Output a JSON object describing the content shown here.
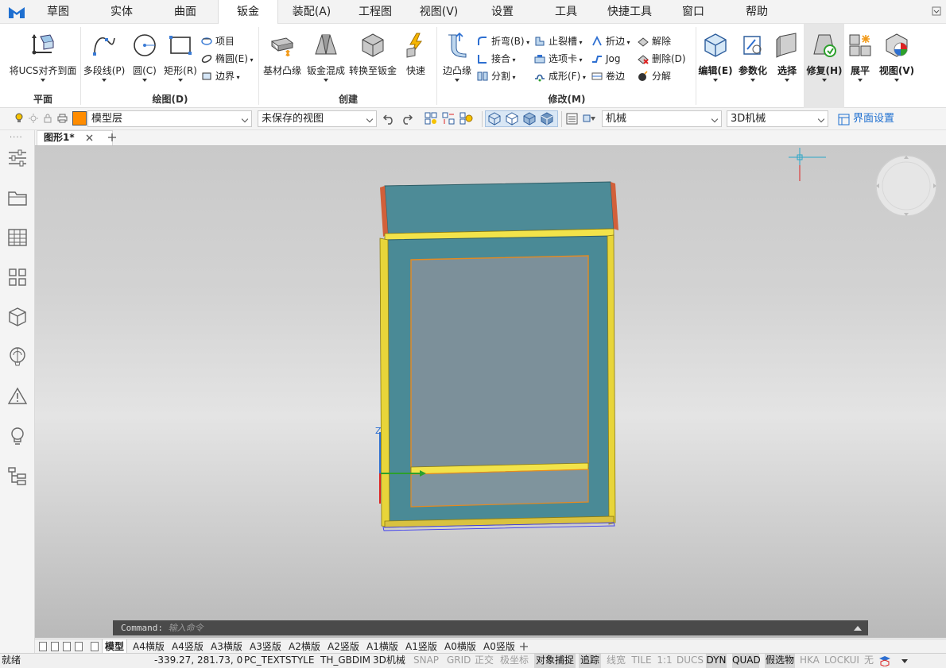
{
  "menubar": {
    "items": [
      "草图",
      "实体",
      "曲面",
      "钣金",
      "装配(A)",
      "工程图",
      "视图(V)",
      "设置",
      "工具",
      "快捷工具",
      "窗口",
      "帮助"
    ],
    "active_index": 3
  },
  "ribbon": {
    "groups": {
      "plane": "平面",
      "draw": "绘图(D)",
      "create": "创建",
      "modify": "修改(M)"
    },
    "buttons": {
      "ucs_align": "将UCS对齐到面",
      "polyline": "多段线(P)",
      "circle": "圆(C)",
      "rectangle": "矩形(R)",
      "item": "项目",
      "ellipse": "椭圆(E)",
      "boundary": "边界",
      "base_flange": "基材凸缘",
      "lofted_bend": "钣金混成",
      "convert_sheet": "转换至钣金",
      "quick": "快速",
      "edge_flange": "边凸缘",
      "bend": "折弯(B)",
      "joint": "接合",
      "split": "分割",
      "relief": "止裂槽",
      "tab": "选项卡",
      "form": "成形(F)",
      "fold": "折边",
      "jog": "Jog",
      "hem": "卷边",
      "unfold": "解除",
      "delete": "删除(D)",
      "explode": "分解",
      "edit": "编辑(E)",
      "parametric": "参数化",
      "select": "选择",
      "repair": "修复(H)",
      "flatten": "展平",
      "view": "视图(V)"
    }
  },
  "toolbar": {
    "layer": "模型层",
    "layer_color": "#ff8c00",
    "saved_view": "未保存的视图",
    "annotation_style": "机械",
    "workspace": "3D机械",
    "ui_settings": "界面设置"
  },
  "document": {
    "tab_title": "图形1*"
  },
  "command": {
    "prompt": "Command:",
    "placeholder": "输入命令"
  },
  "layouts": [
    "模型",
    "A4横版",
    "A4竖版",
    "A3横版",
    "A3竖版",
    "A2横版",
    "A2竖版",
    "A1横版",
    "A1竖版",
    "A0横版",
    "A0竖版"
  ],
  "status": {
    "ready": "就绪",
    "coords": "-339.27, 281.73, 0",
    "textstyle": "PC_TEXTSTYLE",
    "dimstyle": "TH_GBDIM",
    "workspace": "3D机械",
    "toggles": [
      {
        "label": "SNAP",
        "on": false
      },
      {
        "label": "GRID",
        "on": false
      },
      {
        "label": "正交",
        "on": false
      },
      {
        "label": "极坐标",
        "on": false
      },
      {
        "label": "对象捕捉",
        "on": true
      },
      {
        "label": "追踪",
        "on": true
      },
      {
        "label": "线宽",
        "on": false
      },
      {
        "label": "TILE",
        "on": false
      },
      {
        "label": "1:1",
        "on": false
      },
      {
        "label": "DUCS",
        "on": false
      },
      {
        "label": "DYN",
        "on": true
      },
      {
        "label": "QUAD",
        "on": true
      },
      {
        "label": "假选物",
        "on": true
      },
      {
        "label": "HKA",
        "on": false
      },
      {
        "label": "LOCKUI",
        "on": false
      },
      {
        "label": "无",
        "on": false
      }
    ]
  },
  "colors": {
    "accent": "#1e88e5",
    "sheet_teal": "#4a8a96",
    "edge_yellow": "#f2e34a",
    "edge_orange": "#e58a20"
  }
}
